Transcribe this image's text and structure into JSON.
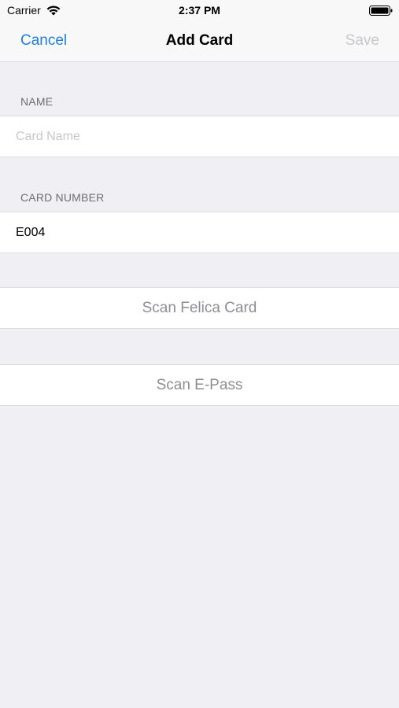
{
  "status_bar": {
    "carrier": "Carrier",
    "time": "2:37 PM"
  },
  "nav": {
    "cancel_label": "Cancel",
    "title": "Add Card",
    "save_label": "Save",
    "accent_color": "#1e7fe0",
    "disabled_color": "#c7c7cc"
  },
  "form": {
    "name_section": {
      "header": "NAME",
      "placeholder": "Card Name",
      "value": ""
    },
    "number_section": {
      "header": "CARD NUMBER",
      "value": "E004"
    }
  },
  "actions": {
    "scan_felica_label": "Scan Felica Card",
    "scan_epass_label": "Scan E-Pass"
  }
}
